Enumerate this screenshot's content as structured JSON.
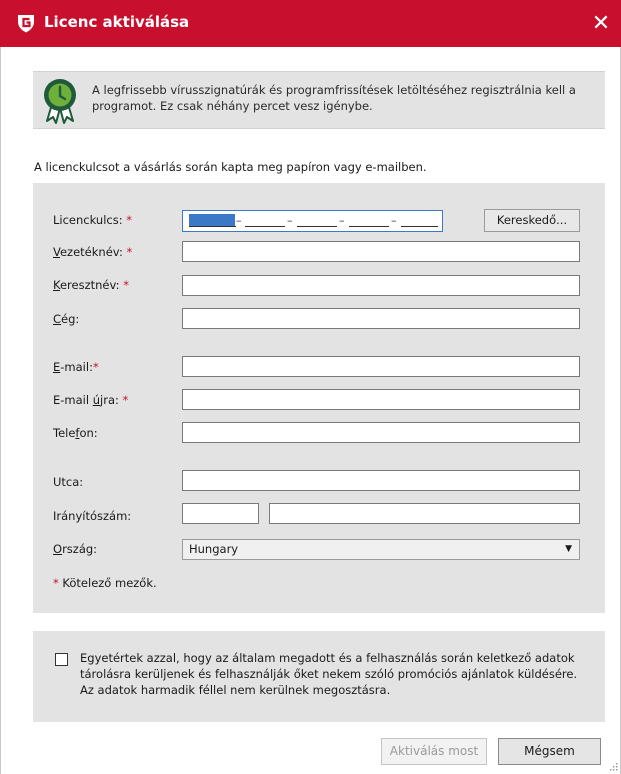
{
  "window": {
    "title": "Licenc aktiválása",
    "close_glyph": "✕",
    "brand_color": "#c8102e",
    "logo_icon": "gdata-shield-icon"
  },
  "info": {
    "icon": "award-ribbon-icon",
    "text": "A legfrissebb vírusszignatúrák és programfrissítések letöltéséhez regisztrálnia kell a programot. Ez csak néhány percet vesz igénybe."
  },
  "intro_text": "A licenckulcsot a vásárlás során kapta meg papíron vagy e-mailben.",
  "form": {
    "license_key": {
      "label": "Licenckulcs:",
      "required_mark": "*",
      "separators": [
        "–",
        "–",
        "–",
        "–"
      ]
    },
    "dealer_button": "Kereskedő...",
    "lastname": {
      "label_u": "V",
      "label_rest": "ezetéknév:",
      "required_mark": "*",
      "value": ""
    },
    "firstname": {
      "label_u": "K",
      "label_rest": "eresztnév:",
      "required_mark": "*",
      "value": ""
    },
    "company": {
      "label_u": "C",
      "label_rest": "ég:",
      "value": ""
    },
    "email": {
      "label_u": "E",
      "label_rest": "-mail:",
      "required_mark": "*",
      "value": ""
    },
    "email_again": {
      "label_pre": "E-mail ",
      "label_u": "ú",
      "label_rest": "jra:",
      "required_mark": "*",
      "value": ""
    },
    "phone": {
      "label_pre": "Tele",
      "label_u": "f",
      "label_rest": "on:",
      "value": ""
    },
    "street": {
      "label": "Utca:",
      "value": ""
    },
    "postal": {
      "label": "Irányítószám:",
      "zip_value": "",
      "city_value": ""
    },
    "country": {
      "label_u": "O",
      "label_rest": "rszág:",
      "selected": "Hungary",
      "arrow": "▼"
    },
    "required_note_mark": "*",
    "required_note": "Kötelező mezők."
  },
  "consent": {
    "checked": false,
    "text": "Egyetértek azzal, hogy az általam megadott és a felhasználás során keletkező adatok tárolásra kerüljenek és felhasználják őket nekem szóló promóciós ajánlatok küldésére. Az adatok harmadik féllel nem kerülnek megosztásra."
  },
  "buttons": {
    "activate": "Aktiválás most",
    "activate_enabled": false,
    "cancel": "Mégsem"
  }
}
